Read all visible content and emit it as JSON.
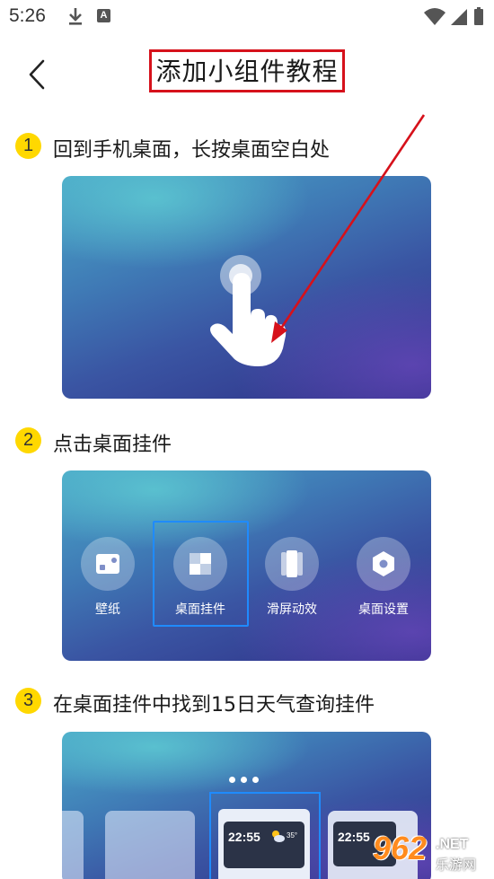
{
  "status_bar": {
    "time": "5:26",
    "icons": [
      "download-icon",
      "a-badge-icon",
      "wifi-icon",
      "signal-icon",
      "battery-icon"
    ],
    "a_badge": "A"
  },
  "header": {
    "back_icon": "chevron-left-icon",
    "title": "添加小组件教程"
  },
  "steps": [
    {
      "number": "1",
      "text": "回到手机桌面，长按桌面空白处"
    },
    {
      "number": "2",
      "text": "点击桌面挂件"
    },
    {
      "number": "3",
      "text": "在桌面挂件中找到15日天气查询挂件"
    }
  ],
  "step2_menu": [
    {
      "label": "壁纸",
      "icon": "wallpaper-icon"
    },
    {
      "label": "桌面挂件",
      "icon": "widget-icon",
      "highlighted": true
    },
    {
      "label": "滑屏动效",
      "icon": "swipe-effect-icon"
    },
    {
      "label": "桌面设置",
      "icon": "settings-hex-icon"
    }
  ],
  "step3_widget": {
    "time": "22:55",
    "temp": "35°",
    "time_right": "22:55"
  },
  "watermark": {
    "brand": "962",
    "suffix": ".NET",
    "sub": "乐游网"
  },
  "colors": {
    "step_badge": "#ffd800",
    "title_border": "#d6111b",
    "highlight_border": "#1f8bff",
    "arrow": "#d6111b"
  }
}
